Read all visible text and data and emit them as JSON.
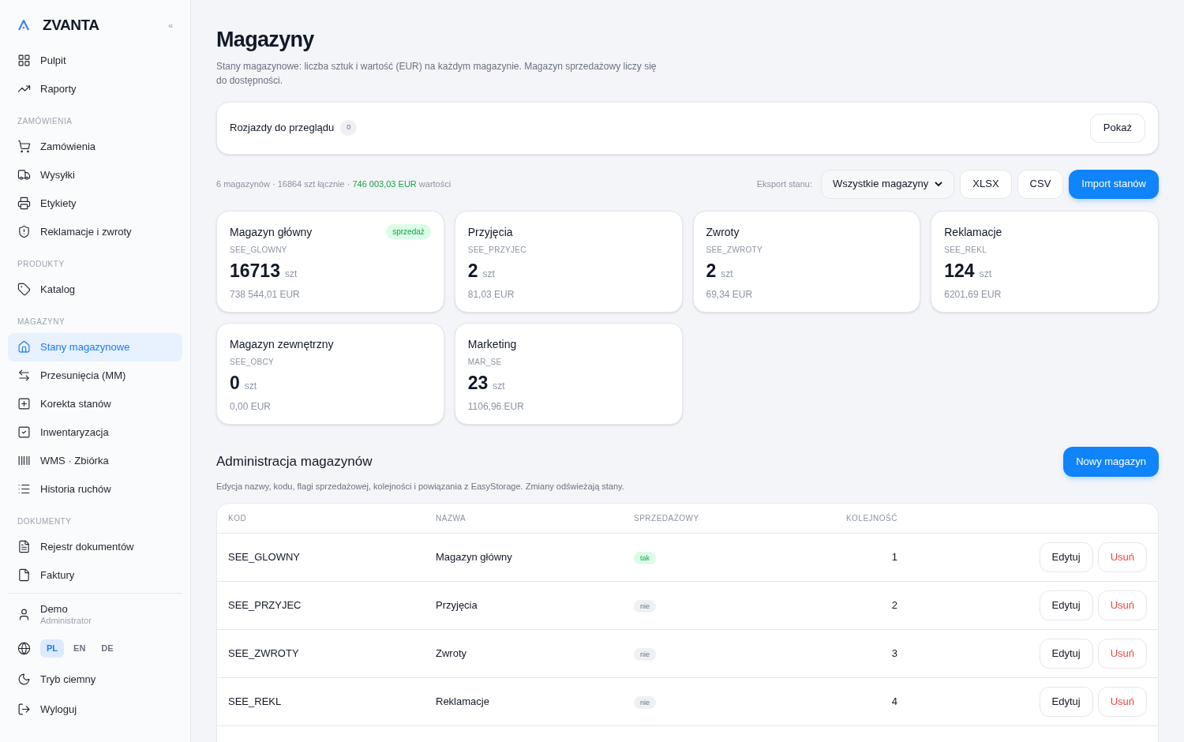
{
  "brand": {
    "logo": "ZVANTA",
    "collapse": "«"
  },
  "nav": [
    {
      "items": [
        {
          "label": "Pulpit",
          "selected": false
        },
        {
          "label": "Raporty",
          "selected": false
        }
      ]
    },
    {
      "heading": "ZAMÓWIENIA",
      "items": [
        {
          "label": "Zamówienia",
          "selected": false
        },
        {
          "label": "Wysyłki",
          "selected": false
        },
        {
          "label": "Etykiety",
          "selected": false
        },
        {
          "label": "Reklamacje i zwroty",
          "selected": false
        }
      ]
    },
    {
      "heading": "PRODUKTY",
      "items": [
        {
          "label": "Katalog",
          "selected": false
        }
      ]
    },
    {
      "heading": "MAGAZYNY",
      "items": [
        {
          "label": "Stany magazynowe",
          "selected": true
        },
        {
          "label": "Przesunięcia (MM)",
          "selected": false
        },
        {
          "label": "Korekta stanów",
          "selected": false
        },
        {
          "label": "Inwentaryzacja",
          "selected": false
        },
        {
          "label": "WMS · Zbiórka",
          "selected": false
        },
        {
          "label": "Historia ruchów",
          "selected": false
        }
      ]
    },
    {
      "heading": "DOKUMENTY",
      "items": [
        {
          "label": "Rejestr dokumentów",
          "selected": false
        },
        {
          "label": "Faktury",
          "selected": false
        }
      ]
    }
  ],
  "user": {
    "name": "Demo",
    "role": "Administrator"
  },
  "languages": [
    {
      "label": "PL",
      "selected": true
    },
    {
      "label": "EN",
      "selected": false
    },
    {
      "label": "DE",
      "selected": false
    }
  ],
  "dark_mode": "Tryb ciemny",
  "logout": "Wyloguj",
  "page": {
    "title": "Magazyny",
    "description": "Stany magazynowe: liczba sztuk i wartość (EUR) na każdym magazynie. Magazyn sprzedażowy liczy się do dostępności."
  },
  "review": {
    "label": "Rozjazdy do przeglądu",
    "count": "0",
    "button": "Pokaż"
  },
  "summary": [
    {
      "kind": "plain",
      "text": "6 magazynów · 16864 szt łącznie ·"
    },
    {
      "kind": "value",
      "text": "746 003,03 EUR"
    },
    {
      "kind": "plain",
      "text": "wartości"
    }
  ],
  "export": {
    "label": "Eksport stanu:",
    "select": "Wszystkie magazyny",
    "buttons": [
      "XLSX",
      "CSV"
    ],
    "import": "Import stanów"
  },
  "warehouses": [
    {
      "name": "Magazyn główny",
      "code": "SEE_GLOWNY",
      "qty": "16713",
      "unit": "szt",
      "value": "738 544,01 EUR",
      "badge": "sprzedaż"
    },
    {
      "name": "Przyjęcia",
      "code": "SEE_PRZYJEC",
      "qty": "2",
      "unit": "szt",
      "value": "81,03 EUR"
    },
    {
      "name": "Zwroty",
      "code": "SEE_ZWROTY",
      "qty": "2",
      "unit": "szt",
      "value": "69,34 EUR"
    },
    {
      "name": "Reklamacje",
      "code": "SEE_REKL",
      "qty": "124",
      "unit": "szt",
      "value": "6201,69 EUR"
    },
    {
      "name": "Magazyn zewnętrzny",
      "code": "SEE_OBCY",
      "qty": "0",
      "unit": "szt",
      "value": "0,00 EUR"
    },
    {
      "name": "Marketing",
      "code": "MAR_SE",
      "qty": "23",
      "unit": "szt",
      "value": "1106,96 EUR"
    }
  ],
  "admin": {
    "title": "Administracja magazynów",
    "description": "Edycja nazwy, kodu, flagi sprzedażowej, kolejności i powiązania z EasyStorage. Zmiany odświeżają stany.",
    "new_button": "Nowy magazyn"
  },
  "table": {
    "columns": [
      "KOD",
      "NAZWA",
      "SPRZEDAŻOWY",
      "KOLEJNOŚĆ"
    ],
    "rows": [
      {
        "code": "SEE_GLOWNY",
        "name": "Magazyn główny",
        "sales": "tak",
        "sales_on": true,
        "order": "1",
        "actions": [
          "Edytuj",
          "Usuń"
        ]
      },
      {
        "code": "SEE_PRZYJEC",
        "name": "Przyjęcia",
        "sales": "nie",
        "sales_on": false,
        "order": "2",
        "actions": [
          "Edytuj",
          "Usuń"
        ]
      },
      {
        "code": "SEE_ZWROTY",
        "name": "Zwroty",
        "sales": "nie",
        "sales_on": false,
        "order": "3",
        "actions": [
          "Edytuj",
          "Usuń"
        ]
      },
      {
        "code": "SEE_REKL",
        "name": "Reklamacje",
        "sales": "nie",
        "sales_on": false,
        "order": "4",
        "actions": [
          "Edytuj",
          "Usuń"
        ]
      }
    ]
  }
}
